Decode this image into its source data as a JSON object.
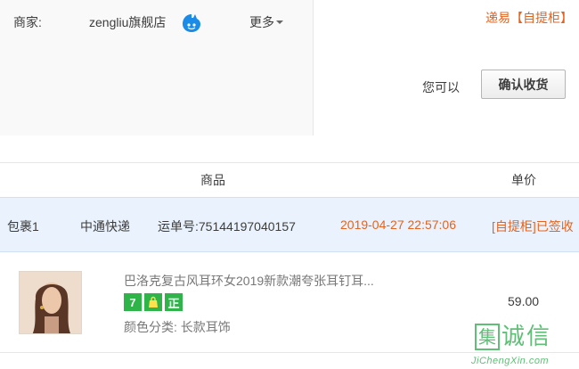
{
  "order_info": {
    "merchant_label": "商家:",
    "shop_name": "zengliu旗舰店",
    "more_label": "更多",
    "delivery_notice": "递易【自提柜】",
    "you_can_label": "您可以",
    "confirm_button_label": "确认收货"
  },
  "table_header": {
    "goods": "商品",
    "price": "单价"
  },
  "package": {
    "number": "包裹1",
    "carrier": "中通快递",
    "tracking": "运单号:75144197040157",
    "time": "2019-04-27 22:57:06",
    "status": "[自提柜]已签收"
  },
  "item": {
    "title": "巴洛克复古风耳环女2019新款潮夸张耳钉耳...",
    "badges": [
      "7",
      "正"
    ],
    "attribute": "颜色分类:  长款耳饰",
    "price": "59.00"
  },
  "watermark": {
    "chars": [
      "集",
      "诚",
      "信"
    ],
    "url": "JiChengXin.com"
  },
  "colors": {
    "accent_orange": "#e4631f",
    "badge_green": "#2fb44a",
    "package_bg": "#eaf3fd"
  }
}
